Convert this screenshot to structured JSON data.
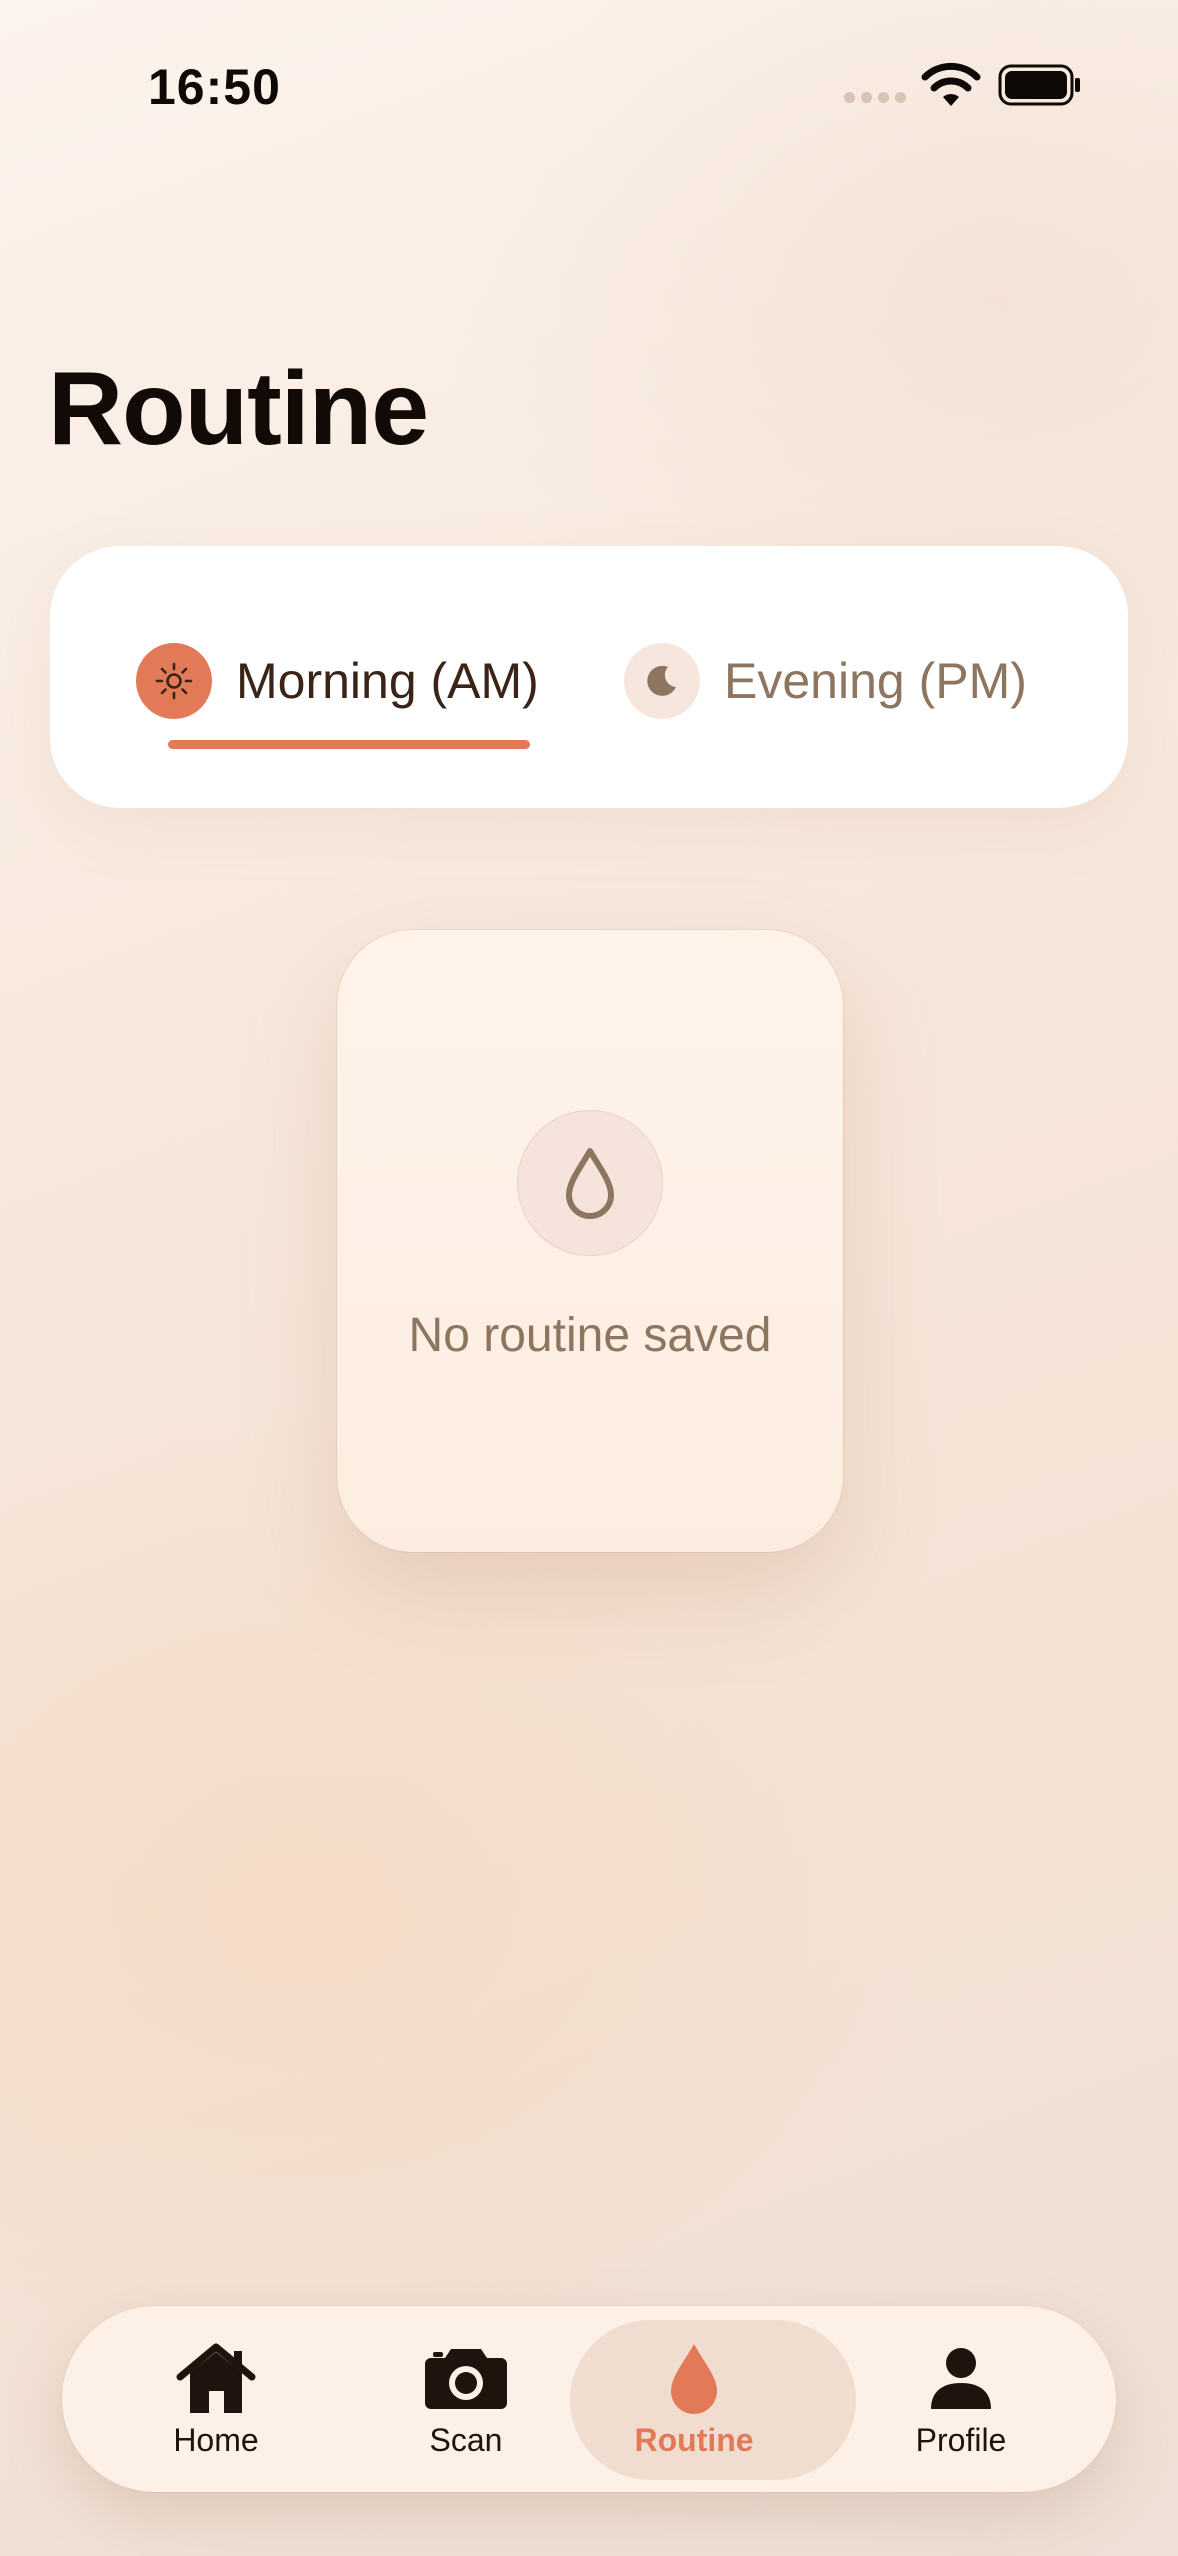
{
  "status_bar": {
    "time": "16:50"
  },
  "page": {
    "title": "Routine"
  },
  "segments": {
    "morning_label": "Morning (AM)",
    "evening_label": "Evening (PM)",
    "selected": "morning"
  },
  "empty_state": {
    "message": "No routine saved",
    "icon": "droplet-icon"
  },
  "tab_bar": {
    "items": [
      {
        "label": "Home",
        "icon": "home-icon"
      },
      {
        "label": "Scan",
        "icon": "camera-icon"
      },
      {
        "label": "Routine",
        "icon": "droplet-icon"
      },
      {
        "label": "Profile",
        "icon": "person-icon"
      }
    ],
    "active": "Routine"
  },
  "colors": {
    "accent": "#E27A57",
    "text_dark": "#1A0F0A",
    "text_muted": "#8E7560"
  }
}
